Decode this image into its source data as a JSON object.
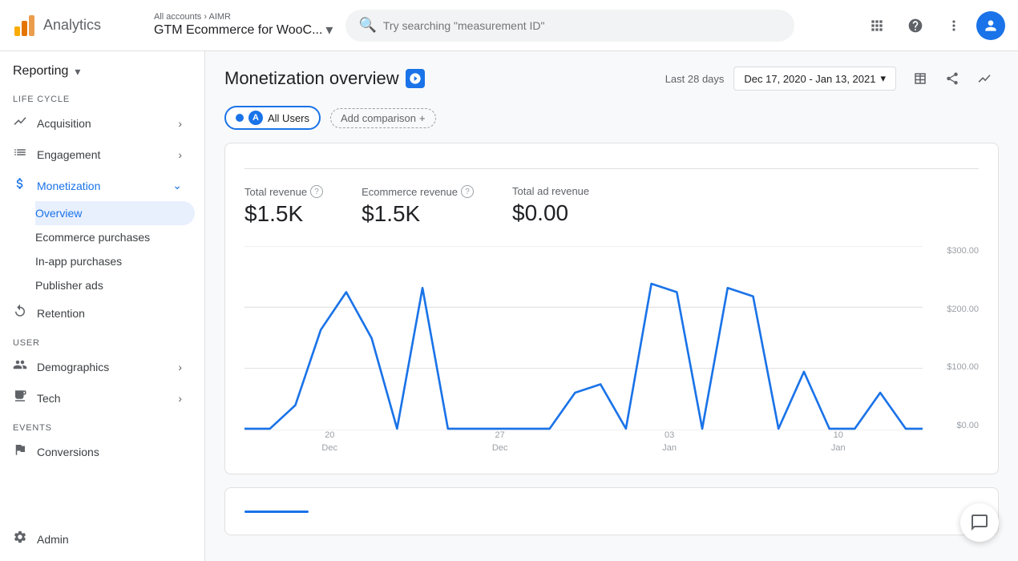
{
  "header": {
    "app_name": "Analytics",
    "breadcrumb": "All accounts › AIMR",
    "account_name": "GTM Ecommerce for WooC...",
    "search_placeholder": "Try searching \"measurement ID\"",
    "apps_icon": "⊞",
    "help_icon": "?",
    "more_icon": "⋮"
  },
  "sidebar": {
    "reporting_label": "Reporting",
    "sections": [
      {
        "label": "LIFE CYCLE",
        "items": [
          {
            "id": "acquisition",
            "label": "Acquisition",
            "icon": "↗",
            "active": false,
            "expandable": true
          },
          {
            "id": "engagement",
            "label": "Engagement",
            "icon": "☰",
            "active": false,
            "expandable": true
          },
          {
            "id": "monetization",
            "label": "Monetization",
            "icon": "$",
            "active": true,
            "expandable": true,
            "children": [
              {
                "id": "overview",
                "label": "Overview",
                "active": true
              },
              {
                "id": "ecommerce-purchases",
                "label": "Ecommerce purchases",
                "active": false
              },
              {
                "id": "in-app-purchases",
                "label": "In-app purchases",
                "active": false
              },
              {
                "id": "publisher-ads",
                "label": "Publisher ads",
                "active": false
              }
            ]
          },
          {
            "id": "retention",
            "label": "Retention",
            "icon": "↺",
            "active": false,
            "expandable": false
          }
        ]
      },
      {
        "label": "USER",
        "items": [
          {
            "id": "demographics",
            "label": "Demographics",
            "icon": "👤",
            "active": false,
            "expandable": true
          },
          {
            "id": "tech",
            "label": "Tech",
            "icon": "💻",
            "active": false,
            "expandable": true
          }
        ]
      },
      {
        "label": "EVENTS",
        "items": [
          {
            "id": "conversions",
            "label": "Conversions",
            "icon": "⚑",
            "active": false,
            "expandable": false
          }
        ]
      }
    ],
    "admin_label": "Admin",
    "admin_icon": "⚙"
  },
  "page": {
    "title": "Monetization overview",
    "title_icon": "📊",
    "last_period_label": "Last 28 days",
    "date_range": "Dec 17, 2020 - Jan 13, 2021",
    "date_dropdown_icon": "▾",
    "toolbar": {
      "table_icon": "⊞",
      "share_icon": "↗",
      "sparkline_icon": "〜"
    },
    "comparison": {
      "segment_label": "All Users",
      "add_comparison_label": "Add comparison",
      "add_icon": "+"
    },
    "metrics": [
      {
        "id": "total-revenue",
        "label": "Total revenue",
        "value": "$1.5K"
      },
      {
        "id": "ecommerce-revenue",
        "label": "Ecommerce revenue",
        "value": "$1.5K"
      },
      {
        "id": "total-ad-revenue",
        "label": "Total ad revenue",
        "value": "$0.00"
      }
    ],
    "chart": {
      "y_labels": [
        "$300.00",
        "$200.00",
        "$100.00",
        "$0.00"
      ],
      "x_labels": [
        {
          "date": "20",
          "month": "Dec"
        },
        {
          "date": "27",
          "month": ""
        },
        {
          "date": "03",
          "month": "Jan"
        },
        {
          "date": "10",
          "month": ""
        }
      ],
      "color": "#1a73e8"
    }
  },
  "chat_icon": "💬"
}
